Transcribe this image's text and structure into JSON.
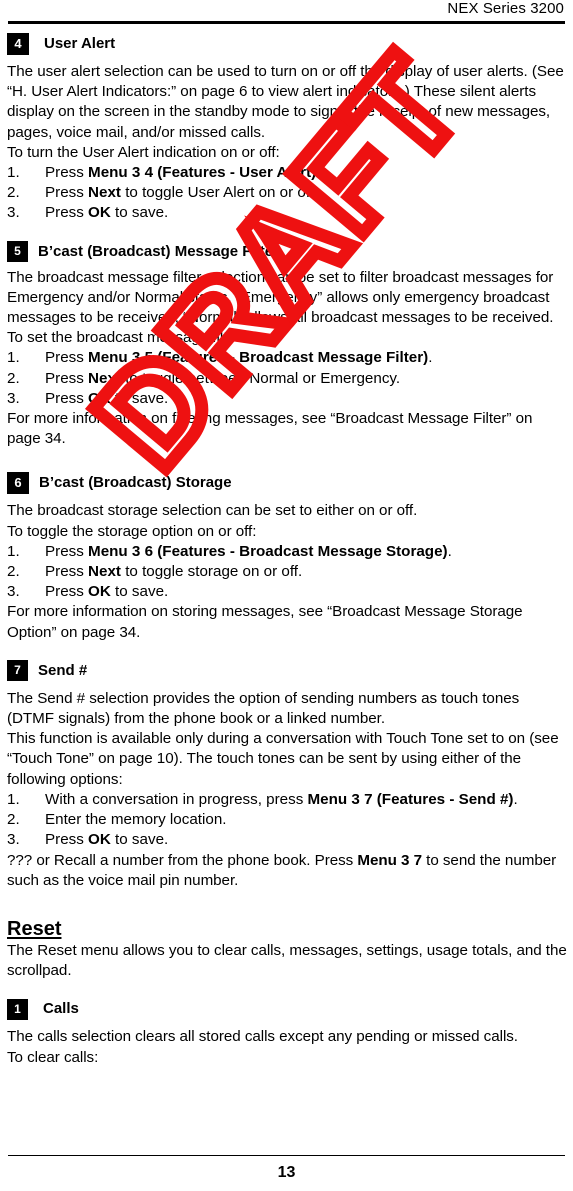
{
  "header": {
    "title": "NEX Series 3200"
  },
  "footer": {
    "page_number": "13"
  },
  "watermark": {
    "text": "DRAFT",
    "color": "#EE1111"
  },
  "sections": [
    {
      "badge": "4",
      "title": "User Alert",
      "paragraphs": [
        "The user alert selection can be used to turn on or off the display of user alerts. (See “H. User Alert Indicators:” on page 6 to view alert indicators.) These silent alerts display on the screen in the standby mode to signal the receipt of new messages, pages, voice mail, and/or missed calls.",
        "To turn the User Alert indication on or off:"
      ],
      "steps": [
        {
          "num": "1.",
          "pre": "Press ",
          "bold": "Menu 3 4 (Features - User Alert)",
          "post": "."
        },
        {
          "num": "2.",
          "pre": "Press ",
          "bold": "Next",
          "post": " to toggle User Alert on or off."
        },
        {
          "num": "3.",
          "pre": "Press ",
          "bold": "OK",
          "post": " to save."
        }
      ],
      "trailing": []
    },
    {
      "badge": "5",
      "title": "B’cast (Broadcast) Message Filter",
      "paragraphs": [
        "The broadcast message filter selection can be set to filter broadcast messages for Emergency and/or Normal status. “Emergency” allows only emergency broadcast messages to be received; “Normal” allows all broadcast messages to be received.",
        "To set the broadcast message filter:"
      ],
      "steps": [
        {
          "num": "1.",
          "pre": "Press ",
          "bold": "Menu 3 5 (Features - Broadcast Message Filter)",
          "post": "."
        },
        {
          "num": "2.",
          "pre": "Press ",
          "bold": "Next",
          "post": " to toggle between Normal or Emergency."
        },
        {
          "num": "3.",
          "pre": "Press ",
          "bold": "OK",
          "post": " to save."
        }
      ],
      "trailing": [
        "For more information on filtering messages, see “Broadcast Message Filter” on page 34."
      ]
    },
    {
      "badge": "6",
      "title": "B’cast (Broadcast) Storage",
      "paragraphs": [
        "The broadcast storage selection can be set to either on or off.",
        "To toggle the storage option on or off:"
      ],
      "steps": [
        {
          "num": "1.",
          "pre": "Press ",
          "bold": "Menu 3 6 (Features - Broadcast Message Storage)",
          "post": "."
        },
        {
          "num": "2.",
          "pre": "Press ",
          "bold": "Next",
          "post": " to toggle storage on or off."
        },
        {
          "num": "3.",
          "pre": "Press ",
          "bold": "OK",
          "post": " to save."
        }
      ],
      "trailing": [
        "For more information on storing messages, see “Broadcast Message Storage Option” on page 34."
      ]
    },
    {
      "badge": "7",
      "title": "Send #",
      "paragraphs": [
        "The Send # selection provides the option of sending numbers as touch tones (DTMF signals) from the phone book or a linked number.",
        "This function is available only during a conversation with Touch Tone set to on (see “Touch Tone” on page 10). The touch tones can be sent by using either of the following options:"
      ],
      "steps": [
        {
          "num": "1.",
          "pre": "With a conversation in progress, press ",
          "bold": "Menu 3 7 (Features - Send #)",
          "post": "."
        },
        {
          "num": "2.",
          "pre": "Enter the memory location.",
          "bold": "",
          "post": ""
        },
        {
          "num": "3.",
          "pre": "Press ",
          "bold": "OK",
          "post": " to save."
        }
      ],
      "trailing_rich": {
        "pre": "??? or Recall a number from the phone book. Press ",
        "bold": "Menu 3 7",
        "post": " to send the number such as the voice mail pin number."
      }
    }
  ],
  "reset": {
    "heading": "Reset",
    "intro": "The Reset menu allows you to clear calls, messages, settings, usage totals, and the scrollpad.",
    "subsection": {
      "badge": "1",
      "title": "Calls",
      "paragraphs": [
        "The calls selection clears all stored calls except any pending or missed calls.",
        "To clear calls:"
      ]
    }
  }
}
